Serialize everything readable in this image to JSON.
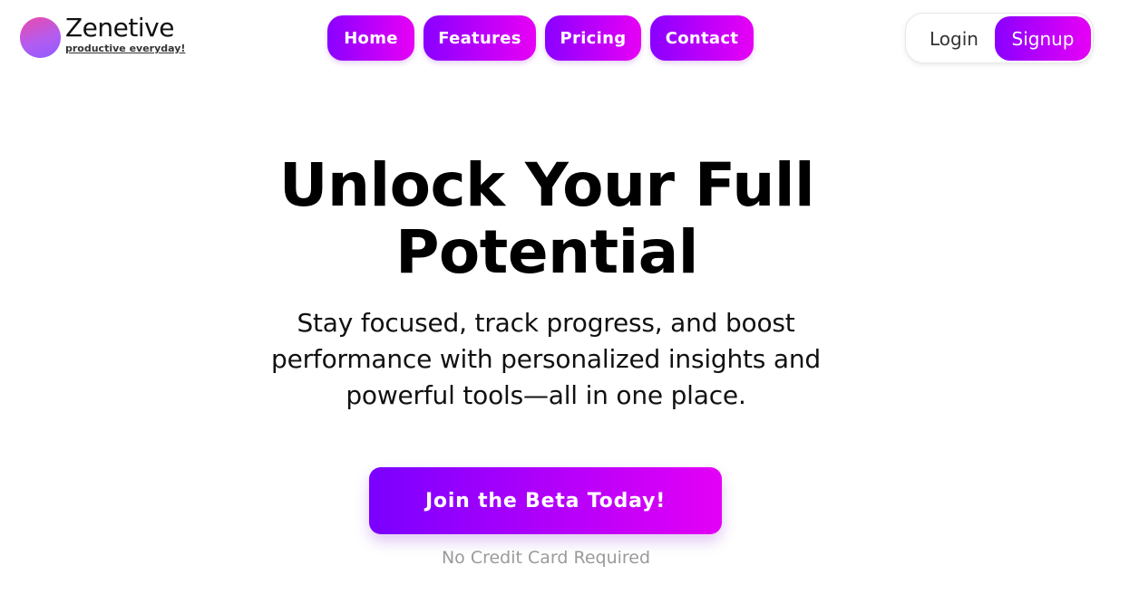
{
  "brand": {
    "name": "Zenetive",
    "tagline": "productive everyday!",
    "logo_icon": "gradient-circle-logo"
  },
  "nav": {
    "items": [
      {
        "label": "Home"
      },
      {
        "label": "Features"
      },
      {
        "label": "Pricing"
      },
      {
        "label": "Contact"
      }
    ]
  },
  "auth": {
    "login_label": "Login",
    "signup_label": "Signup"
  },
  "hero": {
    "title_line1": "Unlock Your Full",
    "title_line2": "Potential",
    "subtitle": "Stay focused, track progress, and boost performance with personalized insights and powerful tools—all in one place.",
    "cta_label": "Join the Beta Today!",
    "cta_note": "No Credit Card Required"
  },
  "colors": {
    "gradient_start": "#8a00ff",
    "gradient_end": "#e800f5",
    "logo_pink": "#ec4aa8",
    "logo_purple": "#8f5cff",
    "note_gray": "#9a9a9a"
  }
}
